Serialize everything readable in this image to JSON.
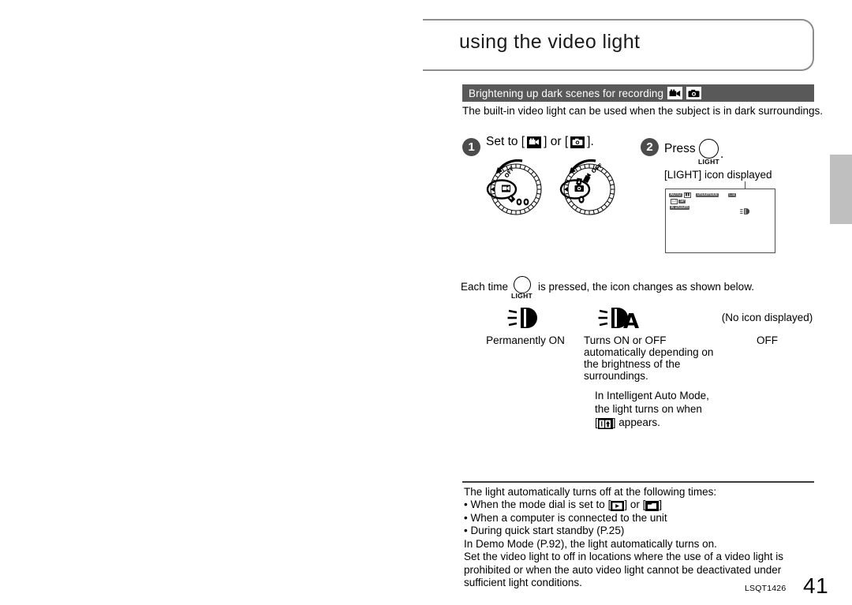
{
  "chapter": {
    "title": "using the video light"
  },
  "section": {
    "heading": "Brightening up dark scenes for recording",
    "mode_icons": [
      "video-mode-icon",
      "photo-mode-icon"
    ]
  },
  "intro": "The built-in video light can be used when the subject is in dark surroundings.",
  "steps": [
    {
      "number": "1",
      "text_before": "Set to [",
      "icon_a": "video-mode-icon",
      "text_middle": "] or [",
      "icon_b": "photo-mode-icon",
      "text_after": "].",
      "dial_labels": {
        "off": "OFF",
        "auto": "AUTO"
      }
    },
    {
      "number": "2",
      "text": "Press",
      "button_label": "LIGHT",
      "button_suffix": ".",
      "caption": "[LIGHT] icon displayed"
    }
  ],
  "lcd": {
    "osd_auto": "AUTO",
    "osd_counter": "0h00m00s",
    "osd_quality": "SP",
    "osd_remaining": "R 1h30m",
    "osd_light_icon": "video-light-icon"
  },
  "each_time": {
    "before": "Each time",
    "button_label": "LIGHT",
    "after": "is pressed, the icon changes as shown below."
  },
  "states": [
    {
      "icon": "video-light-on-icon",
      "caption": "Permanently ON",
      "note": ""
    },
    {
      "icon": "video-light-auto-icon",
      "caption": "Turns ON or OFF automatically depending on the brightness of the surroundings.",
      "note_line1": "In Intelligent Auto Mode,",
      "note_line2": "the light turns on when",
      "note_icon": "intelligent-auto-icon",
      "note_line3": "appears."
    },
    {
      "icon": "",
      "icon_text": "(No icon displayed)",
      "caption": "OFF",
      "note": ""
    }
  ],
  "notes": {
    "line1": "The light automatically turns off at the following times:",
    "bullet1_before": "• When the mode dial is set to [",
    "bullet1_icon_a": "playback-mode-icon",
    "bullet1_middle": "] or [",
    "bullet1_icon_b": "pc-mode-icon",
    "bullet1_after": "]",
    "bullet2": "• When a computer is connected to the unit",
    "bullet3": "• During quick start standby (P.25)",
    "line2": "In Demo Mode (P.92), the light automatically turns on.",
    "line3": "Set the video light to off in locations where the use of a video light is prohibited or when the auto video light cannot be deactivated under sufficient light conditions."
  },
  "footer": {
    "code": "LSQT1426",
    "page_number": "41"
  }
}
